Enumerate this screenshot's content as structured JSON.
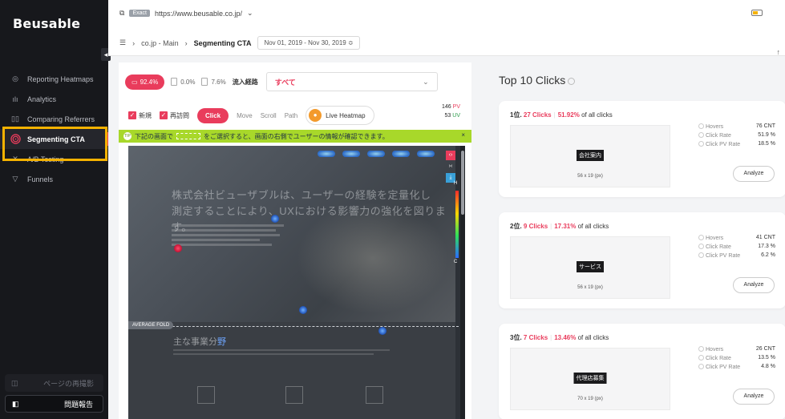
{
  "app": {
    "logo": "Beusable",
    "collapse_icon": "chevron-left-icon"
  },
  "sidebar": {
    "items": [
      {
        "label": "Reporting Heatmaps",
        "icon": "target-icon"
      },
      {
        "label": "Analytics",
        "icon": "bar-chart-icon"
      },
      {
        "label": "Comparing Referrers",
        "icon": "compare-icon"
      },
      {
        "label": "Segmenting CTA",
        "icon": "fingerprint-icon",
        "active": true
      },
      {
        "label": "A/B Testing",
        "icon": "ab-testing-icon"
      },
      {
        "label": "Funnels",
        "icon": "funnel-icon"
      }
    ],
    "bottom": [
      {
        "label": "ページの再撮影",
        "icon": "camera-icon"
      },
      {
        "label": "問題報告",
        "icon": "report-icon"
      }
    ]
  },
  "topbar": {
    "url_badge": "Exact",
    "url": "https://www.beusable.co.jp/",
    "breadcrumb": [
      "co.jp - Main",
      "Segmenting CTA"
    ],
    "date_range": "Nov 01, 2019 - Nov 30, 2019 ≎"
  },
  "left": {
    "segments": [
      {
        "value": "92.4%",
        "selected": true
      },
      {
        "value": "0.0%"
      },
      {
        "value": "7.6%"
      }
    ],
    "source_label": "流入経路",
    "source_value": "すべて",
    "visitor_new": "新規",
    "visitor_return": "再訪問",
    "tabs": [
      "Click",
      "Move",
      "Scroll",
      "Path"
    ],
    "active_tab": "Click",
    "live_heatmap": "Live Heatmap",
    "pv": "146",
    "pv_unit": "PV",
    "uv": "53",
    "uv_unit": "UV",
    "banner_tip": "TIP",
    "banner_text_before": "下記の画面で",
    "banner_text_after": "をご選択すると、画面の右側でユーザーの情報が確認できます。",
    "banner_close": "×"
  },
  "heatmap": {
    "hero_line1": "株式会社ビューザブルは、ユーザーの経験を定量化し",
    "hero_line2": "測定することにより、UXにおける影響力の強化を図ります。",
    "fold_label": "AVERAGE FOLD",
    "section_title": "主な事業分",
    "section_title_accent": "野",
    "legend_high": "H",
    "legend_low": "C"
  },
  "right": {
    "title": "Top 10 Clicks",
    "info_icon": "info-icon",
    "cards": [
      {
        "rank": "1位.",
        "clicks": "27 Clicks",
        "pct": "51.92%",
        "suffix": "of all clicks",
        "tag": "会社案内",
        "size": "56 x 19 (px)",
        "hovers_label": "Hovers",
        "hovers": "76 CNT",
        "click_rate_label": "Click Rate",
        "click_rate": "51.9 %",
        "pv_rate_label": "Click PV Rate",
        "pv_rate": "18.5 %",
        "button": "Analyze"
      },
      {
        "rank": "2位.",
        "clicks": "9 Clicks",
        "pct": "17.31%",
        "suffix": "of all clicks",
        "tag": "サービス",
        "size": "56 x 19 (px)",
        "hovers_label": "Hovers",
        "hovers": "41 CNT",
        "click_rate_label": "Click Rate",
        "click_rate": "17.3 %",
        "pv_rate_label": "Click PV Rate",
        "pv_rate": "6.2 %",
        "button": "Analyze"
      },
      {
        "rank": "3位.",
        "clicks": "7 Clicks",
        "pct": "13.46%",
        "suffix": "of all clicks",
        "tag": "代理店募集",
        "size": "70 x 19 (px)",
        "hovers_label": "Hovers",
        "hovers": "26 CNT",
        "click_rate_label": "Click Rate",
        "click_rate": "13.5 %",
        "pv_rate_label": "Click PV Rate",
        "pv_rate": "4.8 %",
        "button": "Analyze"
      }
    ]
  },
  "colors": {
    "accent": "#e93c5c",
    "sidebar_bg": "#17181c",
    "banner": "#a8d82a",
    "highlight": "#f5b200"
  }
}
